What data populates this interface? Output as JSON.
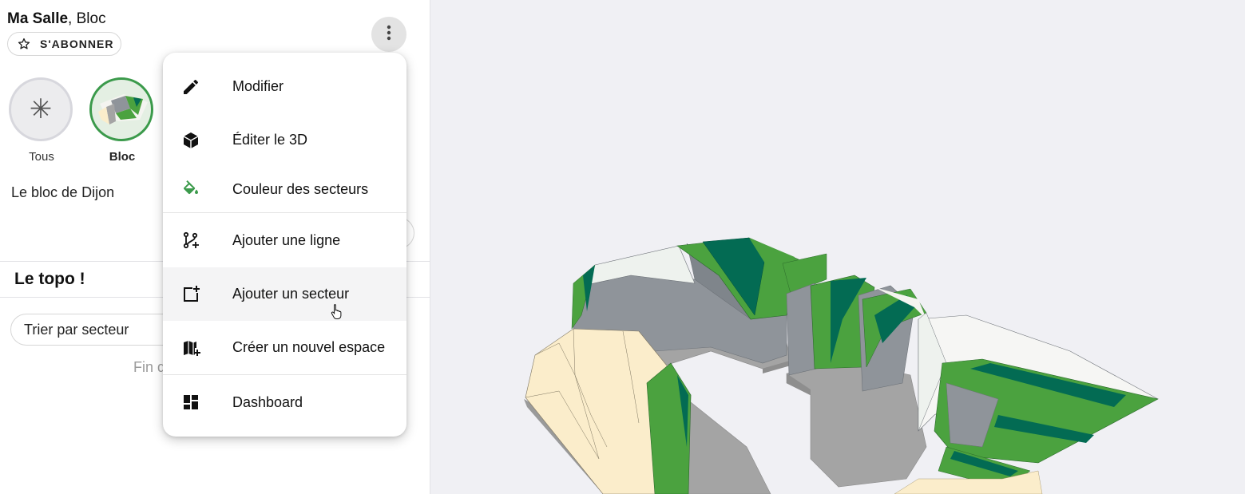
{
  "header": {
    "title_bold": "Ma Salle",
    "title_rest": ", Bloc",
    "subscribe_label": "S'ABONNER"
  },
  "icons": {
    "subscribe": "star-outline-icon",
    "kebab": "more-vert-icon"
  },
  "spaces": [
    {
      "label": "Tous",
      "icon": "asterisk-icon",
      "selected": false
    },
    {
      "label": "Bloc",
      "icon": "bloc-thumbnail",
      "selected": true
    }
  ],
  "description": "Le bloc de Dijon",
  "topo": {
    "title": "Le topo !",
    "sort_label": "Trier par secteur",
    "end_text_fragment": "Fin d"
  },
  "menu": {
    "items": [
      {
        "label": "Modifier",
        "icon": "pencil-icon"
      },
      {
        "label": "Éditer le 3D",
        "icon": "cube-icon"
      },
      {
        "label": "Couleur des secteurs",
        "icon": "paint-bucket-icon"
      },
      {
        "label": "Ajouter une ligne",
        "icon": "source-branch-plus-icon"
      },
      {
        "label": "Ajouter un secteur",
        "icon": "square-plus-icon",
        "hovered": true
      },
      {
        "label": "Créer un nouvel espace",
        "icon": "map-plus-icon"
      },
      {
        "label": "Dashboard",
        "icon": "dashboard-icon"
      }
    ]
  },
  "colors": {
    "accent": "#3b9a4b",
    "sector_green": "#4ba23f",
    "sector_dark_green": "#036b53",
    "wall_grey": "#8f949a",
    "floor_grey": "#a4a4a4",
    "cream": "#fbedcb",
    "viewer_bg": "#f0f0f4"
  }
}
